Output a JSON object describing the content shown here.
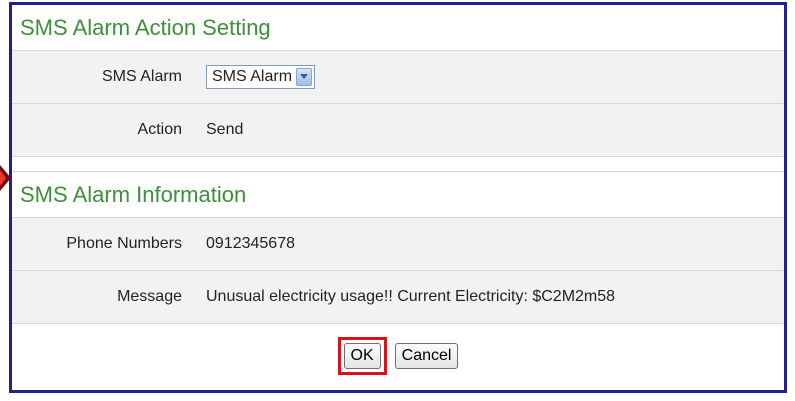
{
  "action_setting": {
    "title": "SMS Alarm Action Setting",
    "sms_alarm_label": "SMS Alarm",
    "sms_alarm_selected": "SMS Alarm",
    "action_label": "Action",
    "action_value": "Send"
  },
  "alarm_info": {
    "title": "SMS Alarm Information",
    "phone_label": "Phone Numbers",
    "phone_value": "0912345678",
    "message_label": "Message",
    "message_value": "Unusual electricity usage!! Current Electricity: $C2M2m58"
  },
  "buttons": {
    "ok_label": "OK",
    "cancel_label": "Cancel"
  },
  "colors": {
    "title_green": "#3f8f3a",
    "frame_blue": "#1f1f8f",
    "highlight_red": "#e0101a"
  }
}
